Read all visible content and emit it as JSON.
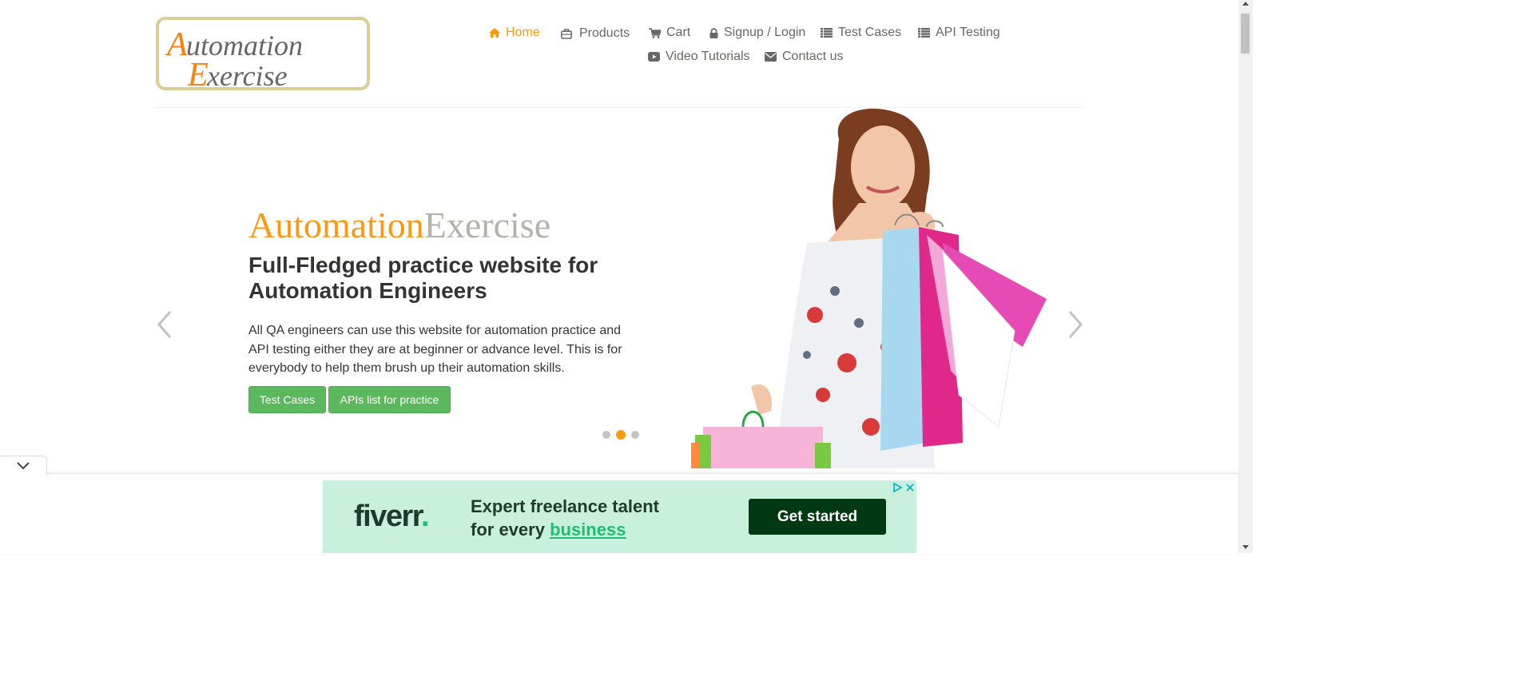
{
  "header": {
    "logo": {
      "line1": "Automation",
      "line2": "Exercise",
      "accent_color": "#fe7f0f"
    },
    "nav": [
      {
        "label": "Home",
        "icon": "home-icon",
        "active": true
      },
      {
        "label": "Products",
        "icon": "briefcase-icon"
      },
      {
        "label": "Cart",
        "icon": "cart-icon"
      },
      {
        "label": "Signup / Login",
        "icon": "lock-icon"
      },
      {
        "label": "Test Cases",
        "icon": "list-icon"
      },
      {
        "label": "API Testing",
        "icon": "list-icon"
      },
      {
        "label": "Video Tutorials",
        "icon": "youtube-play-icon"
      },
      {
        "label": "Contact us",
        "icon": "envelope-icon"
      }
    ]
  },
  "slider": {
    "brand_part1": "Automation",
    "brand_part2": "Exercise",
    "headline": "Full-Fledged practice website for Automation Engineers",
    "description": "All QA engineers can use this website for automation practice and API testing either they are at beginner or advance level. This is for everybody to help them brush up their automation skills.",
    "buttons": {
      "test_cases": "Test Cases",
      "apis": "APIs list for practice"
    },
    "active_slide": 2,
    "slide_count": 3,
    "colors": {
      "brand_orange": "#fe980f",
      "brand_grey": "#b4b1ab",
      "button_green": "#5cb85c"
    }
  },
  "ad": {
    "logo": "fiverr",
    "logo_dot": ".",
    "line1": "Expert freelance talent",
    "line2_prefix": "for every ",
    "line2_link": "business",
    "cta": "Get started",
    "colors": {
      "background": "#c9f0dc",
      "cta_bg": "#003912",
      "accent": "#1dbf73"
    }
  }
}
